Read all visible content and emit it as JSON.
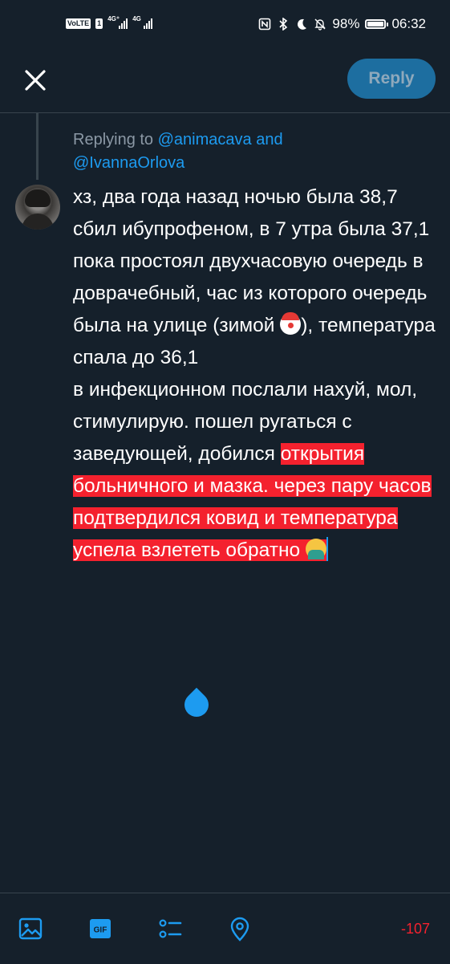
{
  "status_bar": {
    "network_badge": "VoLTE",
    "sim1": "1",
    "network1": "4G⁺",
    "network2": "4G",
    "battery_percent": "98%",
    "battery_level": 0.98,
    "time": "06:32"
  },
  "header": {
    "close_icon": "close-icon",
    "reply_label": "Reply"
  },
  "reply_context": {
    "prefix": "Replying to ",
    "mention1": "@animacava",
    "conjunction": " and",
    "mention2": "@IvannaOrlova"
  },
  "compose": {
    "line1": "хз, два года назад ночью была 38,7",
    "line2": "сбил ибупрофеном, в 7 утра была 37,1",
    "line3a": "пока простоял двухчасовую очередь в доврачебный, час из которого очередь была на улице (зимой ",
    "line3b": "), температура спала до 36,1",
    "line4_normal": "в инфекционном послали нахуй, мол, стимулирую. пошел ругаться с заведующей, добился ",
    "line4_over_limit": "открытия больничного и мазка. через пару часов подтвердился ковид и температура успела взлететь обратно ",
    "emoji1": "clown-face",
    "emoji2": "person-shrugging"
  },
  "toolbar": {
    "icons": [
      "image-icon",
      "gif-icon",
      "poll-icon",
      "location-icon"
    ],
    "gif_text": "GIF",
    "char_counter": "-107"
  },
  "colors": {
    "background": "#15202b",
    "accent": "#1d9bf0",
    "over_limit": "#f4212e",
    "muted": "#8b98a5"
  }
}
